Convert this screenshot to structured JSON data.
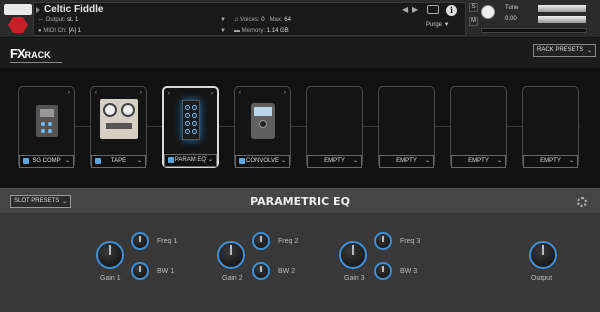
{
  "header": {
    "title": "Celtic Fiddle",
    "output_label": "Output:",
    "output_value": "st. 1",
    "voices_label": "Voices:",
    "voices_value": "0",
    "max_label": "Max:",
    "max_value": "64",
    "midi_label": "MIDI Ch:",
    "midi_value": "[A] 1",
    "memory_label": "Memory:",
    "memory_value": "1.14 GB",
    "purge_label": "Purge",
    "tune_label": "Tune",
    "tune_value": "0.00",
    "s_button": "S",
    "m_button": "M",
    "info_button": "i"
  },
  "toolbar": {
    "logo_fx": "FX",
    "logo_rack": "RACK",
    "rack_presets": "RACK PRESETS"
  },
  "slots": [
    {
      "label": "SG COMP"
    },
    {
      "label": "TAPE"
    },
    {
      "label": "PARAM EQ"
    },
    {
      "label": "CONVOLVE"
    },
    {
      "label": "EMPTY"
    },
    {
      "label": "EMPTY"
    },
    {
      "label": "EMPTY"
    },
    {
      "label": "EMPTY"
    }
  ],
  "eq": {
    "slot_presets": "SLOT PRESETS",
    "title": "PARAMETRIC EQ",
    "bands": [
      {
        "gain": "Gain 1",
        "freq": "Freq 1",
        "bw": "BW 1"
      },
      {
        "gain": "Gain 2",
        "freq": "Freq 2",
        "bw": "BW 2"
      },
      {
        "gain": "Gain 3",
        "freq": "Freq 3",
        "bw": "BW 3"
      }
    ],
    "output": "Output"
  },
  "colors": {
    "accent": "#3f8fd6",
    "logo_red": "#c61f28"
  }
}
